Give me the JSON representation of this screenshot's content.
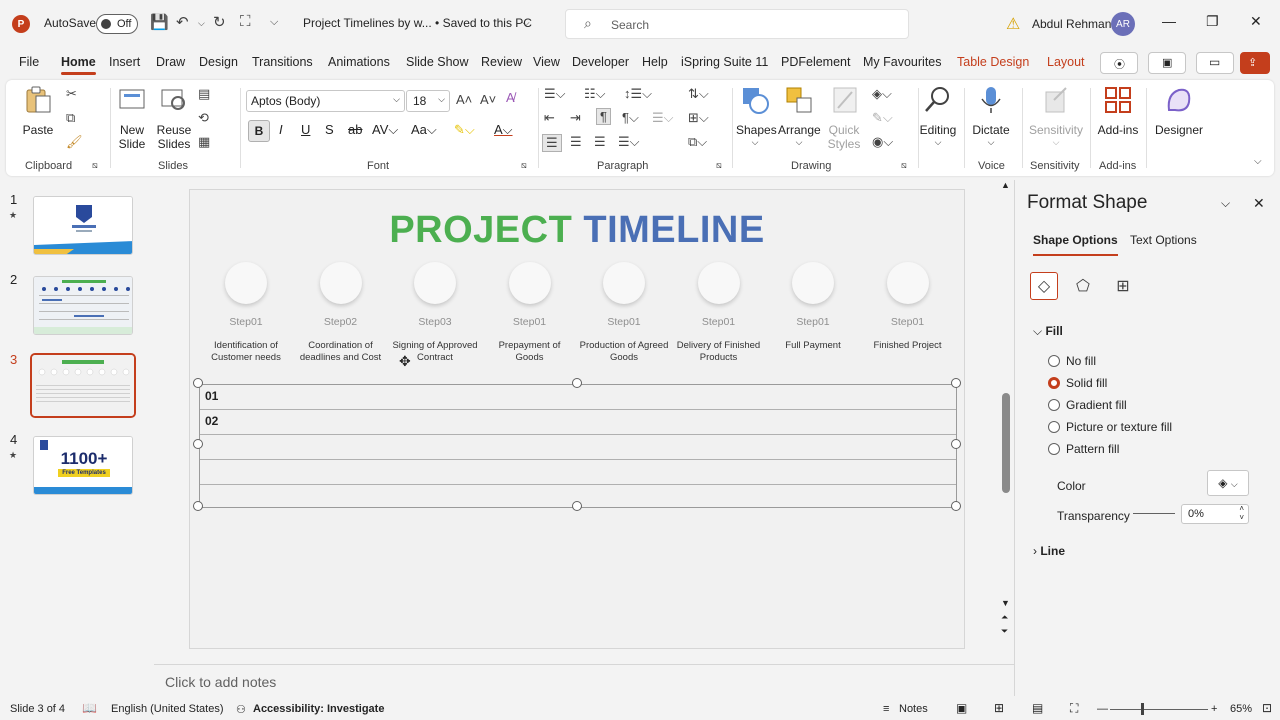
{
  "titlebar": {
    "logo_letter": "P",
    "autosave_label": "AutoSave",
    "autosave_state": "Off",
    "doc_title": "Project Timelines by w...  •  Saved to this PC",
    "search_placeholder": "Search",
    "user_name": "Abdul Rehman",
    "user_initials": "AR"
  },
  "tabs": [
    "File",
    "Home",
    "Insert",
    "Draw",
    "Design",
    "Transitions",
    "Animations",
    "Slide Show",
    "Review",
    "View",
    "Developer",
    "Help",
    "iSpring Suite 11",
    "PDFelement",
    "My Favourites",
    "Table Design",
    "Layout"
  ],
  "active_tab": "Home",
  "ribbon": {
    "clipboard": {
      "paste": "Paste",
      "label": "Clipboard"
    },
    "slides": {
      "new_slide": "New Slide",
      "reuse_slides": "Reuse Slides",
      "label": "Slides"
    },
    "font": {
      "name": "Aptos (Body)",
      "size": "18",
      "label": "Font"
    },
    "paragraph": {
      "label": "Paragraph"
    },
    "drawing": {
      "shapes": "Shapes",
      "arrange": "Arrange",
      "quick_styles": "Quick Styles",
      "label": "Drawing"
    },
    "editing": {
      "label": "Editing"
    },
    "voice": {
      "dictate": "Dictate",
      "label": "Voice"
    },
    "sensitivity": {
      "btn": "Sensitivity",
      "label": "Sensitivity"
    },
    "addins": {
      "btn": "Add-ins",
      "label": "Add-ins"
    },
    "designer": {
      "btn": "Designer"
    }
  },
  "thumbnails": [
    {
      "num": "1",
      "star": "★"
    },
    {
      "num": "2",
      "star": ""
    },
    {
      "num": "3",
      "star": ""
    },
    {
      "num": "4",
      "star": "★",
      "promo": "1100+",
      "promo_sub": "Free Templates"
    }
  ],
  "slide": {
    "title_part1": "PROJECT",
    "title_part2": "TIMELINE",
    "steps": [
      {
        "label": "Step01",
        "desc": "Identification of Customer needs"
      },
      {
        "label": "Step02",
        "desc": "Coordination of deadlines and Cost"
      },
      {
        "label": "Step03",
        "desc": "Signing of Approved Contract"
      },
      {
        "label": "Step01",
        "desc": "Prepayment of Goods"
      },
      {
        "label": "Step01",
        "desc": "Production of Agreed Goods"
      },
      {
        "label": "Step01",
        "desc": "Delivery of Finished Products"
      },
      {
        "label": "Step01",
        "desc": "Full Payment"
      },
      {
        "label": "Step01",
        "desc": "Finished Project"
      }
    ],
    "table_rows": [
      "01",
      "02",
      "",
      "",
      ""
    ]
  },
  "notes_placeholder": "Click to add notes",
  "format_pane": {
    "title": "Format Shape",
    "tab_shape": "Shape Options",
    "tab_text": "Text Options",
    "fill_header": "Fill",
    "fill_options": [
      "No fill",
      "Solid fill",
      "Gradient fill",
      "Picture or texture fill",
      "Pattern fill"
    ],
    "fill_selected": "Solid fill",
    "color_label": "Color",
    "transparency_label": "Transparency",
    "transparency_value": "0%",
    "line_header": "Line"
  },
  "status": {
    "slide_info": "Slide 3 of 4",
    "language": "English (United States)",
    "accessibility": "Accessibility: Investigate",
    "notes": "Notes",
    "zoom": "65%"
  },
  "colors": {
    "accent": "#c43e1c",
    "title_green": "#4caf50",
    "title_blue": "#4a6fb5"
  }
}
